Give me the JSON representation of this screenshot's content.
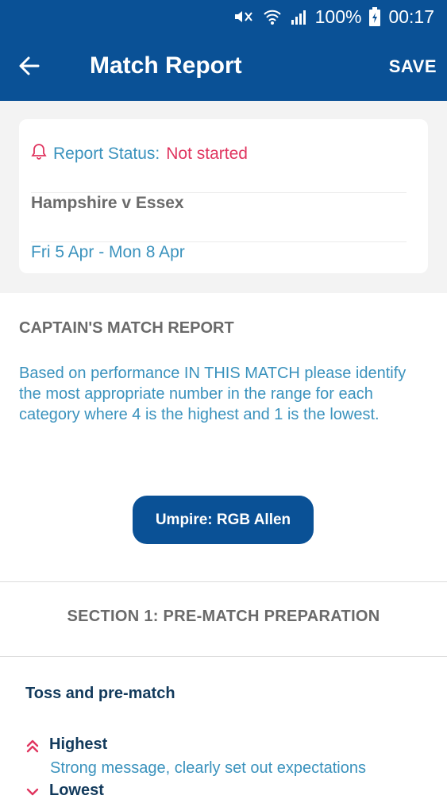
{
  "status_bar": {
    "battery": "100%",
    "time": "00:17"
  },
  "toolbar": {
    "title": "Match Report",
    "save_label": "SAVE"
  },
  "match": {
    "status_label": "Report Status:",
    "status_value": "Not started",
    "teams": "Hampshire v Essex",
    "dates": "Fri 5 Apr - Mon 8 Apr"
  },
  "report": {
    "heading": "CAPTAIN'S MATCH REPORT",
    "instructions": "Based on performance IN THIS MATCH please identify the most appropriate number in the range for each category where 4 is the highest and 1 is the lowest.",
    "umpire_button": "Umpire: RGB Allen"
  },
  "section": {
    "title": "SECTION 1: PRE-MATCH PREPARATION",
    "category": "Toss and pre-match",
    "highest_label": "Highest",
    "highest_desc": "Strong message, clearly set out expectations",
    "lowest_label": "Lowest"
  },
  "colors": {
    "primary": "#0a5196",
    "accent_text": "#3a92bd",
    "alert": "#e0355f"
  }
}
